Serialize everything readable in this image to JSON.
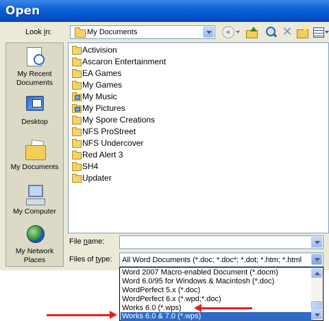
{
  "window": {
    "title": "Open"
  },
  "toolbar": {
    "lookin_label_pre": "Look ",
    "lookin_label_accel": "i",
    "lookin_label_post": "n:",
    "lookin_value": "My Documents",
    "icons": [
      "back-icon",
      "up-folder-icon",
      "search-web-icon",
      "delete-icon",
      "new-folder-icon",
      "views-icon"
    ]
  },
  "places": [
    {
      "label": "My Recent Documents",
      "icon": "recent-documents-icon"
    },
    {
      "label": "Desktop",
      "icon": "desktop-icon"
    },
    {
      "label": "My Documents",
      "icon": "my-documents-icon"
    },
    {
      "label": "My Computer",
      "icon": "my-computer-icon"
    },
    {
      "label": "My Network Places",
      "icon": "network-places-icon"
    }
  ],
  "files": [
    "Activision",
    "Ascaron Entertainment",
    "EA Games",
    "My Games",
    "My Music",
    "My Pictures",
    "My Spore Creations",
    "NFS ProStreet",
    "NFS Undercover",
    "Red Alert 3",
    "SH4",
    "Updater"
  ],
  "filename": {
    "label_pre": "File ",
    "label_accel": "n",
    "label_post": "ame:",
    "value": ""
  },
  "filetype": {
    "label_pre": "Files of ",
    "label_accel": "t",
    "label_post": "ype:",
    "value": "All Word Documents (*.doc; *.doc*; *.dot; *.htm; *.html"
  },
  "filetype_options": [
    "Word 2007 Macro-enabled Document (*.docm)",
    "Word 6.0/95 for Windows & Macintosh (*.doc)",
    "WordPerfect 5.x (*.doc)",
    "WordPerfect 6.x (*.wpd;*.doc)",
    "Works 6.0 (*.wps)",
    "Works 6.0 & 7.0 (*.wps)"
  ],
  "filetype_selected_index": 5,
  "colors": {
    "title_bar": "#0a5fd8",
    "dialog_bg": "#ece9d8",
    "selection": "#316ac5",
    "annotation_arrow": "#e8201a"
  }
}
